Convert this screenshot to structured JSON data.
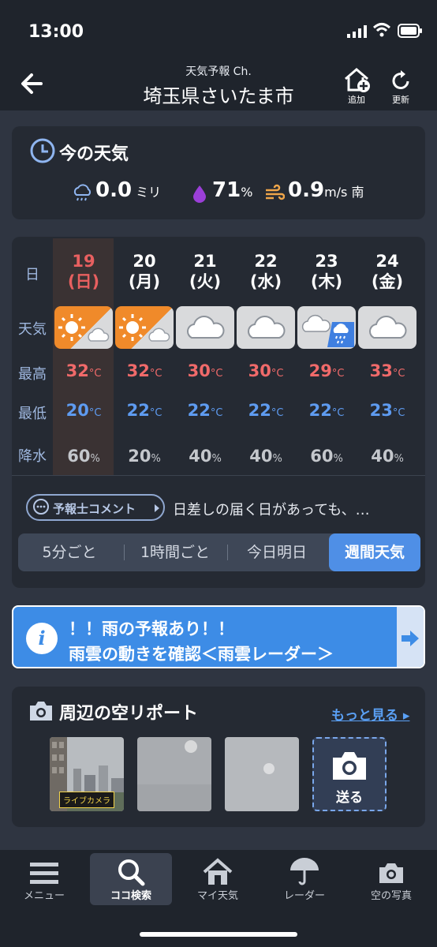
{
  "status": {
    "time": "13:00"
  },
  "header": {
    "subtitle": "天気予報 Ch.",
    "title": "埼玉県さいたま市",
    "add_label": "追加",
    "refresh_label": "更新"
  },
  "now": {
    "title": "今の天気",
    "rain_value": "0.0",
    "rain_unit": "ミリ",
    "humidity_value": "71",
    "humidity_unit": "%",
    "wind_value": "0.9",
    "wind_unit": "m/s",
    "wind_dir": "南"
  },
  "week": {
    "row_labels": {
      "day": "日",
      "weather": "天気",
      "high": "最高",
      "low": "最低",
      "rain": "降水"
    },
    "temp_unit": "°C",
    "rain_unit": "%",
    "days": [
      {
        "date": "19",
        "dow": "(日)",
        "weather": "sunny-then-cloudy",
        "high": "32",
        "low": "20",
        "rain": "60"
      },
      {
        "date": "20",
        "dow": "(月)",
        "weather": "sunny-then-cloudy",
        "high": "32",
        "low": "22",
        "rain": "20"
      },
      {
        "date": "21",
        "dow": "(火)",
        "weather": "cloudy",
        "high": "30",
        "low": "22",
        "rain": "40"
      },
      {
        "date": "22",
        "dow": "(水)",
        "weather": "cloudy",
        "high": "30",
        "low": "22",
        "rain": "40"
      },
      {
        "date": "23",
        "dow": "(木)",
        "weather": "cloudy-then-rain",
        "high": "29",
        "low": "22",
        "rain": "60"
      },
      {
        "date": "24",
        "dow": "(金)",
        "weather": "cloudy",
        "high": "33",
        "low": "23",
        "rain": "40"
      }
    ],
    "comment_label": "予報士コメント",
    "comment_text": "日差しの届く日があっても、…",
    "tabs": [
      "5分ごと",
      "1時間ごと",
      "今日明日",
      "週間天気"
    ],
    "active_tab": "週間天気"
  },
  "banner": {
    "line1": "！！雨の予報あり！！",
    "line2": "雨雲の動きを確認＜雨雲レーダー＞"
  },
  "sky": {
    "title": "周辺の空リポート",
    "more": "もっと見る",
    "live_tag": "ライブカメラ",
    "send": "送る"
  },
  "nav": {
    "menu": "メニュー",
    "search": "ココ検索",
    "my": "マイ天気",
    "radar": "レーダー",
    "photo": "空の写真"
  },
  "colors": {
    "high": "#f06a6a",
    "low": "#5e9bf0",
    "accent": "#4f8fe6",
    "today": "#e86060"
  }
}
